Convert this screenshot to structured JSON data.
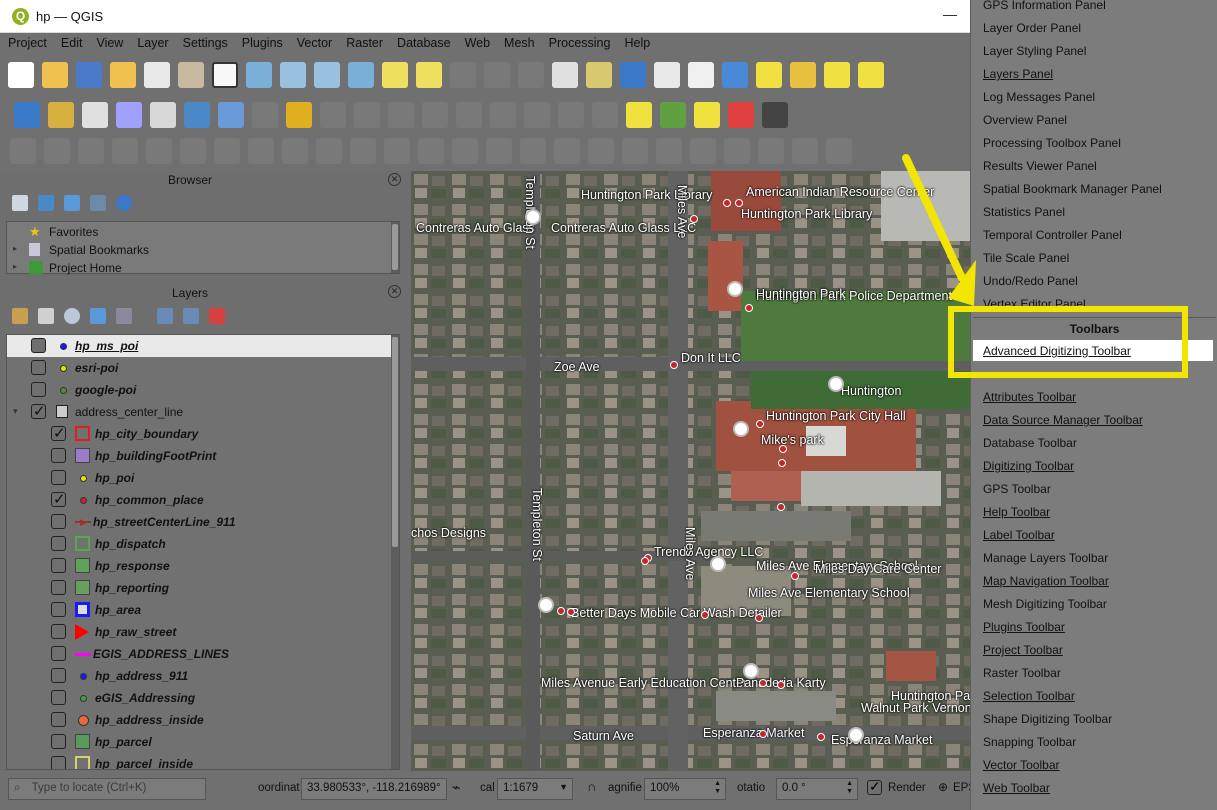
{
  "window": {
    "title": "hp — QGIS",
    "minimize": "—"
  },
  "menubar": [
    "Project",
    "Edit",
    "View",
    "Layer",
    "Settings",
    "Plugins",
    "Vector",
    "Raster",
    "Database",
    "Web",
    "Mesh",
    "Processing",
    "Help"
  ],
  "browser_panel": {
    "title": "Browser",
    "items": [
      {
        "label": "Favorites",
        "icon": "star-icon"
      },
      {
        "label": "Spatial Bookmarks",
        "icon": "bookmark-icon"
      },
      {
        "label": "Project Home",
        "icon": "project-home-icon"
      }
    ]
  },
  "layers_panel": {
    "title": "Layers",
    "layers": [
      {
        "name": "hp_ms_poi",
        "checked": false,
        "symbol": "dot",
        "color": "#1a1aff",
        "indent": 0,
        "selected": true
      },
      {
        "name": "esri-poi",
        "checked": false,
        "symbol": "dot",
        "color": "#e5e500",
        "indent": 0
      },
      {
        "name": "google-poi",
        "checked": false,
        "symbol": "dot",
        "color": "#5a8a3a",
        "indent": 0
      },
      {
        "name": "address_center_line",
        "checked": true,
        "symbol": "group",
        "color": "",
        "indent": 0,
        "group": true
      },
      {
        "name": "hp_city_boundary",
        "checked": true,
        "symbol": "square-outline",
        "color": "#e02020",
        "indent": 1
      },
      {
        "name": "hp_buildingFootPrint",
        "checked": false,
        "symbol": "square",
        "color": "#9b7cc8",
        "indent": 1
      },
      {
        "name": "hp_poi",
        "checked": false,
        "symbol": "dot",
        "color": "#e5e500",
        "indent": 1
      },
      {
        "name": "hp_common_place",
        "checked": true,
        "symbol": "dot",
        "color": "#c2272d",
        "indent": 1
      },
      {
        "name": "hp_streetCenterLine_911",
        "checked": false,
        "symbol": "arrow-line",
        "color": "#a03030",
        "indent": 1
      },
      {
        "name": "hp_dispatch",
        "checked": false,
        "symbol": "square-outline",
        "color": "#56a84d",
        "indent": 1
      },
      {
        "name": "hp_response",
        "checked": false,
        "symbol": "square",
        "color": "#5fa05a",
        "indent": 1
      },
      {
        "name": "hp_reporting",
        "checked": false,
        "symbol": "square",
        "color": "#6a9e5e",
        "indent": 1
      },
      {
        "name": "hp_area",
        "checked": false,
        "symbol": "square-thick",
        "color": "#1a1aff",
        "indent": 1
      },
      {
        "name": "hp_raw_street",
        "checked": false,
        "symbol": "triangle",
        "color": "#ff0000",
        "indent": 1
      },
      {
        "name": "EGIS_ADDRESS_LINES",
        "checked": false,
        "symbol": "line",
        "color": "#ff00ff",
        "indent": 1
      },
      {
        "name": "hp_address_911",
        "checked": false,
        "symbol": "dot",
        "color": "#1a1aff",
        "indent": 1
      },
      {
        "name": "eGIS_Addressing",
        "checked": false,
        "symbol": "dot",
        "color": "#4a9a4a",
        "indent": 1
      },
      {
        "name": "hp_address_inside",
        "checked": false,
        "symbol": "dot-big",
        "color": "#e86a3a",
        "indent": 1
      },
      {
        "name": "hp_parcel",
        "checked": false,
        "symbol": "square",
        "color": "#5c9a5c",
        "indent": 1
      },
      {
        "name": "hp_parcel_inside",
        "checked": false,
        "symbol": "square-outline",
        "color": "#d8d070",
        "indent": 1
      }
    ]
  },
  "map": {
    "labels": [
      {
        "text": "Huntington Park Library"
      },
      {
        "text": "American Indian Resource Center"
      },
      {
        "text": "Huntington Park Library"
      },
      {
        "text": "Contreras Auto Glass"
      },
      {
        "text": "Contreras Auto Glass LLC"
      },
      {
        "text": "Huntington Park Police Department"
      },
      {
        "text": "Zoe Ave"
      },
      {
        "text": "Don It LLC"
      },
      {
        "text": "Huntington Park City Hall"
      },
      {
        "text": "Mike's park"
      },
      {
        "text": "Trendz Agency LLC"
      },
      {
        "text": "Miles Ave Elementary School"
      },
      {
        "text": "Miles Ave Elementary School"
      },
      {
        "text": "Miles Day Care Center"
      },
      {
        "text": "Better Days Mobile Car Wash Detailer"
      },
      {
        "text": "Miles Avenue Early Education Center"
      },
      {
        "text": "Panaderia Karty"
      },
      {
        "text": "Esperanza Market"
      },
      {
        "text": "Esperanza Market"
      },
      {
        "text": "Saturn Ave"
      },
      {
        "text": "Templeton St"
      },
      {
        "text": "Miles Ave"
      },
      {
        "text": "Templeton St"
      },
      {
        "text": "Miles Ave"
      },
      {
        "text": "Huntington Park"
      },
      {
        "text": "Huntington"
      },
      {
        "text": "Huntington Park"
      },
      {
        "text": "Walnut Park Vernon"
      },
      {
        "text": "chos Designs"
      }
    ]
  },
  "statusbar": {
    "locate_placeholder": "Type to locate (Ctrl+K)",
    "coord_label": "oordinat",
    "coordinate": "33.980533°, -118.216989°",
    "scale_label": "cal",
    "scale": "1:1679",
    "magnifier_label": "agnifie",
    "magnifier": "100%",
    "rotation_label": "otatio",
    "rotation": "0.0 °",
    "render_label": "Render",
    "crs_label": "EPS"
  },
  "context_menu": {
    "panels": [
      {
        "label": "GPS Information Panel",
        "u": false
      },
      {
        "label": "Layer Order Panel",
        "u": false
      },
      {
        "label": "Layer Styling Panel",
        "u": false
      },
      {
        "label": "Layers Panel",
        "u": true
      },
      {
        "label": "Log Messages Panel",
        "u": false
      },
      {
        "label": "Overview Panel",
        "u": false
      },
      {
        "label": "Processing Toolbox Panel",
        "u": false
      },
      {
        "label": "Results Viewer Panel",
        "u": false
      },
      {
        "label": "Spatial Bookmark Manager Panel",
        "u": false
      },
      {
        "label": "Statistics Panel",
        "u": false
      },
      {
        "label": "Temporal Controller Panel",
        "u": false
      },
      {
        "label": "Tile Scale Panel",
        "u": false
      },
      {
        "label": "Undo/Redo Panel",
        "u": false
      },
      {
        "label": "Vertex Editor Panel",
        "u": false
      }
    ],
    "toolbars_heading": "Toolbars",
    "highlighted": "Advanced Digitizing Toolbar",
    "toolbars": [
      {
        "label": "Attributes Toolbar",
        "u": true
      },
      {
        "label": "Data Source Manager Toolbar",
        "u": true
      },
      {
        "label": "Database Toolbar",
        "u": false
      },
      {
        "label": "Digitizing Toolbar",
        "u": true
      },
      {
        "label": "GPS Toolbar",
        "u": false
      },
      {
        "label": "Help Toolbar",
        "u": true
      },
      {
        "label": "Label Toolbar",
        "u": true
      },
      {
        "label": "Manage Layers Toolbar",
        "u": false
      },
      {
        "label": "Map Navigation Toolbar",
        "u": true
      },
      {
        "label": "Mesh Digitizing Toolbar",
        "u": false
      },
      {
        "label": "Plugins Toolbar",
        "u": true
      },
      {
        "label": "Project Toolbar",
        "u": true
      },
      {
        "label": "Raster Toolbar",
        "u": false
      },
      {
        "label": "Selection Toolbar",
        "u": true
      },
      {
        "label": "Shape Digitizing Toolbar",
        "u": false
      },
      {
        "label": "Snapping Toolbar",
        "u": false
      },
      {
        "label": "Vector Toolbar",
        "u": true
      },
      {
        "label": "Web Toolbar",
        "u": true
      }
    ]
  },
  "annotation": {
    "highlight_color": "#f2e600"
  }
}
